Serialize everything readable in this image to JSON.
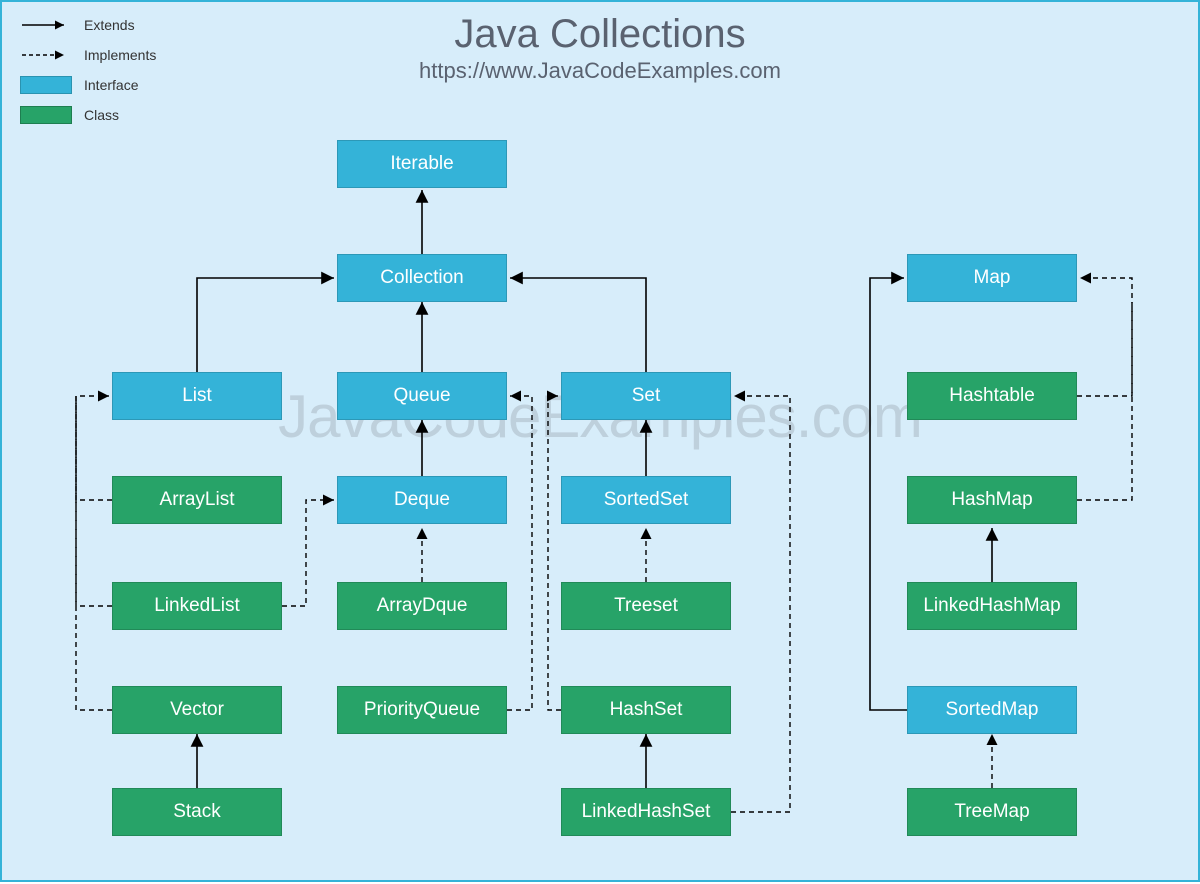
{
  "title": "Java Collections",
  "subtitle": "https://www.JavaCodeExamples.com",
  "watermark": "JavaCodeExamples.com",
  "legend": {
    "extends": "Extends",
    "implements": "Implements",
    "interface": "Interface",
    "class": "Class"
  },
  "colors": {
    "interface": "#34b3d8",
    "class": "#27a368",
    "background": "#d7edfa"
  },
  "nodes": {
    "Iterable": "Iterable",
    "Collection": "Collection",
    "List": "List",
    "Queue": "Queue",
    "Set": "Set",
    "Deque": "Deque",
    "SortedSet": "SortedSet",
    "ArrayList": "ArrayList",
    "LinkedList": "LinkedList",
    "Vector": "Vector",
    "Stack": "Stack",
    "ArrayDque": "ArrayDque",
    "PriorityQueue": "PriorityQueue",
    "Treeset": "Treeset",
    "HashSet": "HashSet",
    "LinkedHashSet": "LinkedHashSet",
    "Map": "Map",
    "Hashtable": "Hashtable",
    "HashMap": "HashMap",
    "LinkedHashMap": "LinkedHashMap",
    "SortedMap": "SortedMap",
    "TreeMap": "TreeMap"
  },
  "edges": [
    {
      "from": "Collection",
      "to": "Iterable",
      "type": "extends"
    },
    {
      "from": "List",
      "to": "Collection",
      "type": "extends"
    },
    {
      "from": "Queue",
      "to": "Collection",
      "type": "extends"
    },
    {
      "from": "Set",
      "to": "Collection",
      "type": "extends"
    },
    {
      "from": "Deque",
      "to": "Queue",
      "type": "extends"
    },
    {
      "from": "SortedSet",
      "to": "Set",
      "type": "extends"
    },
    {
      "from": "ArrayList",
      "to": "List",
      "type": "implements"
    },
    {
      "from": "LinkedList",
      "to": "List",
      "type": "implements"
    },
    {
      "from": "LinkedList",
      "to": "Deque",
      "type": "implements"
    },
    {
      "from": "Vector",
      "to": "List",
      "type": "implements"
    },
    {
      "from": "Stack",
      "to": "Vector",
      "type": "extends"
    },
    {
      "from": "ArrayDque",
      "to": "Deque",
      "type": "implements"
    },
    {
      "from": "PriorityQueue",
      "to": "Queue",
      "type": "implements"
    },
    {
      "from": "Treeset",
      "to": "SortedSet",
      "type": "implements"
    },
    {
      "from": "HashSet",
      "to": "Set",
      "type": "implements"
    },
    {
      "from": "LinkedHashSet",
      "to": "HashSet",
      "type": "extends"
    },
    {
      "from": "LinkedHashSet",
      "to": "Set",
      "type": "implements"
    },
    {
      "from": "Hashtable",
      "to": "Map",
      "type": "implements"
    },
    {
      "from": "HashMap",
      "to": "Map",
      "type": "implements"
    },
    {
      "from": "LinkedHashMap",
      "to": "HashMap",
      "type": "extends"
    },
    {
      "from": "SortedMap",
      "to": "Map",
      "type": "extends"
    },
    {
      "from": "TreeMap",
      "to": "SortedMap",
      "type": "implements"
    }
  ]
}
